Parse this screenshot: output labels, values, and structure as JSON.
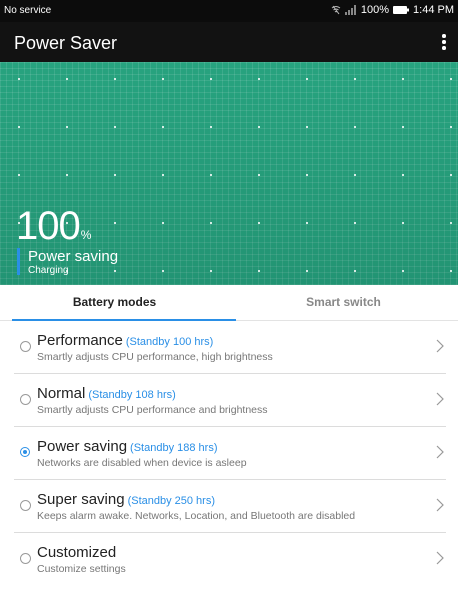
{
  "status_bar": {
    "carrier": "No service",
    "battery_percent": "100%",
    "time": "1:44 PM"
  },
  "app_bar": {
    "title": "Power Saver",
    "menu_icon": "more-vert-icon"
  },
  "battery_panel": {
    "level": "100",
    "unit": "%",
    "mode": "Power saving",
    "status": "Charging",
    "colors": {
      "background": "#27a37f",
      "accent": "#2a8fe6"
    }
  },
  "tabs": [
    {
      "label": "Battery modes",
      "active": true
    },
    {
      "label": "Smart switch",
      "active": false
    }
  ],
  "modes": [
    {
      "title": "Performance",
      "standby": "(Standby 100 hrs)",
      "desc": "Smartly adjusts CPU performance, high brightness",
      "selected": false
    },
    {
      "title": "Normal",
      "standby": "(Standby 108 hrs)",
      "desc": "Smartly adjusts CPU performance and brightness",
      "selected": false
    },
    {
      "title": "Power saving",
      "standby": "(Standby 188 hrs)",
      "desc": "Networks are disabled when device is asleep",
      "selected": true
    },
    {
      "title": "Super saving",
      "standby": "(Standby 250 hrs)",
      "desc": "Keeps alarm awake. Networks, Location, and Bluetooth are disabled",
      "selected": false
    },
    {
      "title": "Customized",
      "standby": "",
      "desc": "Customize settings",
      "selected": false
    }
  ]
}
